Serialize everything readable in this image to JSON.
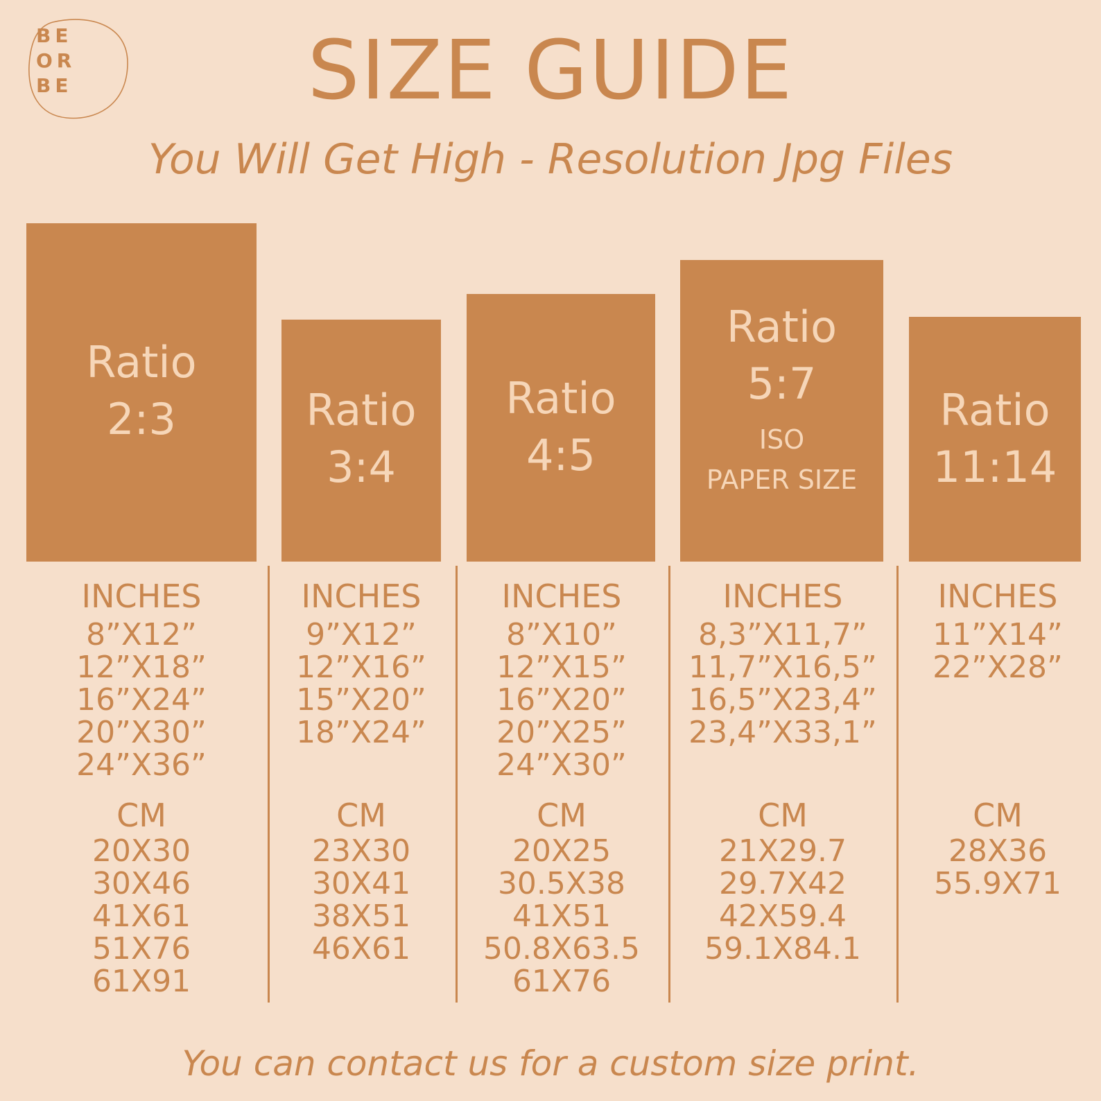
{
  "logo": {
    "line1": "BE",
    "line2": "OR",
    "line3": "BE"
  },
  "header": {
    "title": "SIZE GUIDE",
    "subtitle": "You Will Get High - Resolution Jpg Files"
  },
  "columns": [
    {
      "ratio_label": "Ratio",
      "ratio_value": "2:3",
      "extra": [],
      "inches_label": "INCHES",
      "inches": [
        "8”X12”",
        "12”X18”",
        "16”X24”",
        "20”X30”",
        "24”X36”"
      ],
      "cm_label": "CM",
      "cm": [
        "20X30",
        "30X46",
        "41X61",
        "51X76",
        "61X91"
      ]
    },
    {
      "ratio_label": "Ratio",
      "ratio_value": "3:4",
      "extra": [],
      "inches_label": "INCHES",
      "inches": [
        "9”X12”",
        "12”X16”",
        "15”X20”",
        "18”X24”"
      ],
      "cm_label": "CM",
      "cm": [
        "23X30",
        "30X41",
        "38X51",
        "46X61"
      ]
    },
    {
      "ratio_label": "Ratio",
      "ratio_value": "4:5",
      "extra": [],
      "inches_label": "INCHES",
      "inches": [
        "8”X10”",
        "12”X15”",
        "16”X20”",
        "20”X25”",
        "24”X30”"
      ],
      "cm_label": "CM",
      "cm": [
        "20X25",
        "30.5X38",
        "41X51",
        "50.8X63.5",
        "61X76"
      ]
    },
    {
      "ratio_label": "Ratio",
      "ratio_value": "5:7",
      "extra": [
        "ISO",
        "PAPER SIZE"
      ],
      "inches_label": "INCHES",
      "inches": [
        "8,3”X11,7”",
        "11,7”X16,5”",
        "16,5”X23,4”",
        "23,4”X33,1”"
      ],
      "cm_label": "CM",
      "cm": [
        "21X29.7",
        "29.7X42",
        "42X59.4",
        "59.1X84.1"
      ]
    },
    {
      "ratio_label": "Ratio",
      "ratio_value": "11:14",
      "extra": [],
      "inches_label": "INCHES",
      "inches": [
        "11”X14”",
        "22”X28”"
      ],
      "cm_label": "CM",
      "cm": [
        "28X36",
        "55.9X71"
      ]
    }
  ],
  "footer": {
    "text": "You can contact us for a custom size print."
  },
  "colors": {
    "background": "#f6dfcb",
    "accent": "#c9874f",
    "box_text": "#f6d6b8"
  }
}
